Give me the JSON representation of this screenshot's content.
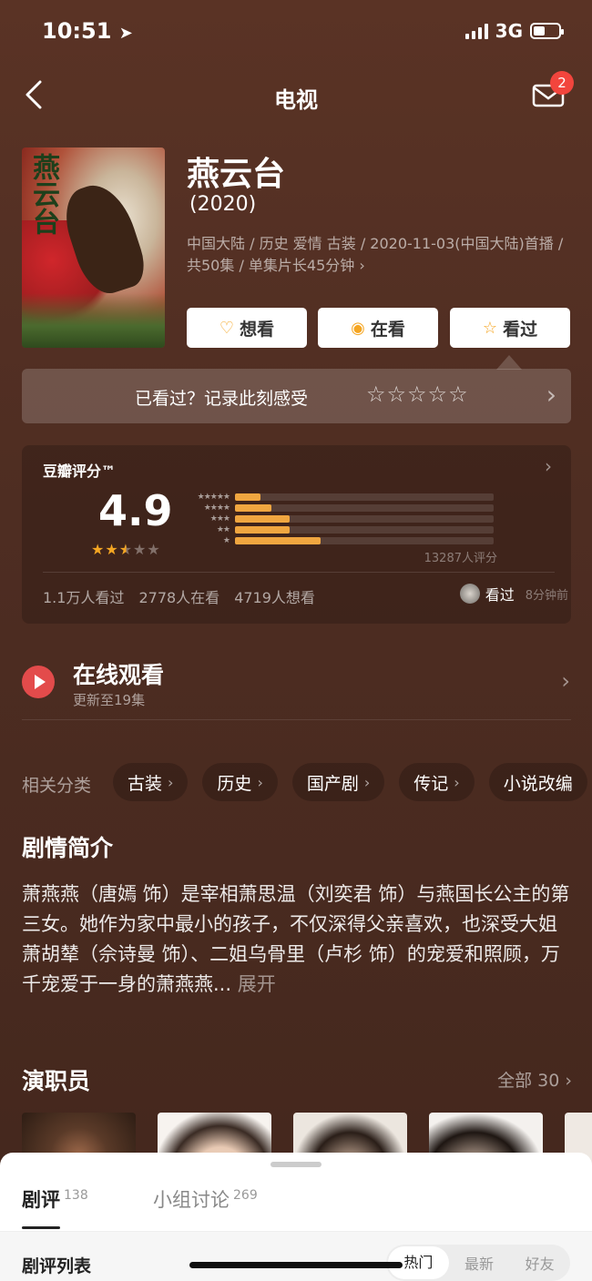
{
  "status": {
    "time": "10:51",
    "network": "3G",
    "battery_level": 0.45
  },
  "nav": {
    "title": "电视",
    "badge_count": "2"
  },
  "movie": {
    "poster_title": "燕云台",
    "title": "燕云台",
    "year": "(2020)",
    "meta": "中国大陆 / 历史 爱情 古装 / 2020-11-03(中国大陆)首播 / 共50集 / 单集片长45分钟 ›"
  },
  "actions": {
    "want": "想看",
    "watching": "在看",
    "watched": "看过"
  },
  "record": {
    "prompt": "已看过？记录此刻感受",
    "stars": "☆☆☆☆☆"
  },
  "rating": {
    "label": "豆瓣评分™",
    "score": "4.9",
    "stars_on": "★★",
    "stars_half": "★",
    "stars_off": "★★",
    "distribution": [
      {
        "stars": "★★★★★",
        "fraction": 0.1
      },
      {
        "stars": "★★★★",
        "fraction": 0.14
      },
      {
        "stars": "★★★",
        "fraction": 0.21
      },
      {
        "stars": "★★",
        "fraction": 0.21
      },
      {
        "stars": "★",
        "fraction": 0.33
      }
    ],
    "count": "13287人评分",
    "watched": "1.1万人看过",
    "watching": "2778人在看",
    "want": "4719人想看",
    "friend_action": "看过",
    "friend_time": "8分钟前"
  },
  "online": {
    "title": "在线观看",
    "subtitle": "更新至19集"
  },
  "tags": {
    "label": "相关分类",
    "items": [
      "古装",
      "历史",
      "国产剧",
      "传记",
      "小说改编"
    ]
  },
  "synopsis": {
    "title": "剧情简介",
    "text": "萧燕燕（唐嫣 饰）是宰相萧思温（刘奕君 饰）与燕国长公主的第三女。她作为家中最小的孩子，不仅深得父亲喜欢，也深受大姐萧胡辇（佘诗曼 饰）、二姐乌骨里（卢杉 饰）的宠爱和照顾，万千宠爱于一身的萧燕燕...",
    "more": "展开"
  },
  "cast": {
    "title": "演职员",
    "all": "全部 30 ›"
  },
  "sheet": {
    "tab_reviews": "剧评",
    "tab_reviews_count": "138",
    "tab_groups": "小组讨论",
    "tab_groups_count": "269",
    "list_label": "剧评列表",
    "sort_hot": "热门",
    "sort_new": "最新",
    "sort_friends": "好友"
  }
}
